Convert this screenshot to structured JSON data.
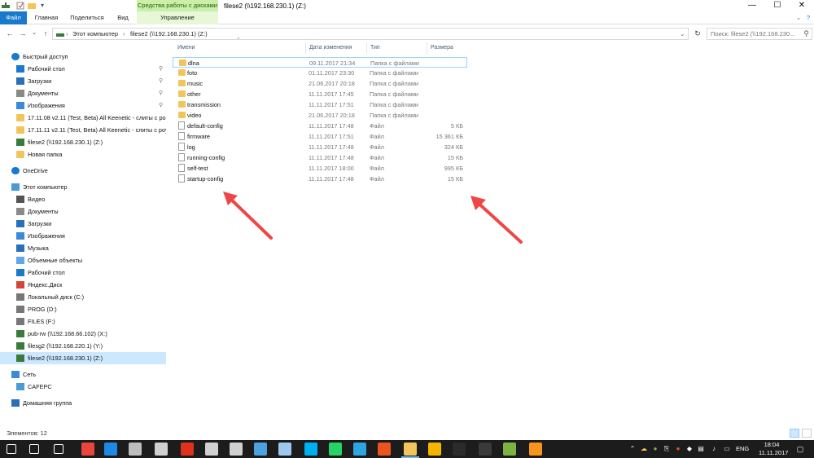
{
  "window": {
    "title": "filese2 (\\\\192.168.230.1) (Z:)",
    "ctx_tab_header": "Средства работы с дисками",
    "controls": {
      "minimize": "—",
      "maximize": "☐",
      "close": "✕"
    }
  },
  "ribbon": {
    "tabs": [
      "Файл",
      "Главная",
      "Поделиться",
      "Вид",
      "Управление"
    ]
  },
  "address": {
    "crumbs": [
      "Этот компьютер",
      "›",
      "filese2 (\\\\192.168.230.1) (Z:)"
    ],
    "search_placeholder": "Поиск: filese2 (\\\\192.168.230..."
  },
  "nav": {
    "items": [
      {
        "label": "Быстрый доступ",
        "icon": "star-icon",
        "pinned": false
      },
      {
        "label": "Рабочий стол",
        "icon": "desktop-icon",
        "pinned": true
      },
      {
        "label": "Загрузки",
        "icon": "download-icon",
        "pinned": true
      },
      {
        "label": "Документы",
        "icon": "documents-icon",
        "pinned": true
      },
      {
        "label": "Изображения",
        "icon": "pictures-icon",
        "pinned": true
      },
      {
        "label": "17.11.08 v2.11 (Test, Beta) All Keenetic - слиты с ро",
        "icon": "folder-icon",
        "pinned": false
      },
      {
        "label": "17.11.11 v2.11 (Test, Beta) All Keenetic - слиты с роу",
        "icon": "folder-icon",
        "pinned": false
      },
      {
        "label": "filese2 (\\\\192.168.230.1) (Z:)",
        "icon": "network-drive-icon",
        "pinned": false
      },
      {
        "label": "Новая папка",
        "icon": "folder-icon",
        "pinned": false
      },
      {
        "label": "OneDrive",
        "icon": "cloud-icon",
        "pinned": false
      },
      {
        "label": "Этот компьютер",
        "icon": "computer-icon",
        "pinned": false
      },
      {
        "label": "Видео",
        "icon": "video-icon",
        "pinned": false
      },
      {
        "label": "Документы",
        "icon": "documents-icon",
        "pinned": false
      },
      {
        "label": "Загрузки",
        "icon": "download-icon",
        "pinned": false
      },
      {
        "label": "Изображения",
        "icon": "pictures-icon",
        "pinned": false
      },
      {
        "label": "Музыка",
        "icon": "music-icon",
        "pinned": false
      },
      {
        "label": "Объемные объекты",
        "icon": "3d-objects-icon",
        "pinned": false
      },
      {
        "label": "Рабочий стол",
        "icon": "desktop-icon",
        "pinned": false
      },
      {
        "label": "Яндекс.Диск",
        "icon": "yandex-disk-icon",
        "pinned": false
      },
      {
        "label": "Локальный диск (C:)",
        "icon": "drive-icon",
        "pinned": false
      },
      {
        "label": "PROG (D:)",
        "icon": "drive-icon",
        "pinned": false
      },
      {
        "label": "FILES (F:)",
        "icon": "drive-icon",
        "pinned": false
      },
      {
        "label": "pub-rw (\\\\192.168.66.102) (X:)",
        "icon": "network-drive-icon",
        "pinned": false
      },
      {
        "label": "filesg2 (\\\\192.168.220.1) (Y:)",
        "icon": "network-drive-icon",
        "pinned": false
      },
      {
        "label": "filese2 (\\\\192.168.230.1) (Z:)",
        "icon": "network-drive-icon",
        "pinned": false,
        "selected": true
      },
      {
        "label": "Сеть",
        "icon": "network-icon",
        "pinned": false
      },
      {
        "label": "CAFEPC",
        "icon": "computer-icon",
        "pinned": false
      },
      {
        "label": "Домашняя группа",
        "icon": "homegroup-icon",
        "pinned": false
      }
    ]
  },
  "columns": {
    "name": "Имени",
    "date": "Дата изменения",
    "type": "Тип",
    "size": "Размера"
  },
  "files": [
    {
      "name": "dlna",
      "date": "09.11.2017 21:34",
      "type": "Папка с файлами",
      "size": "",
      "kind": "folder"
    },
    {
      "name": "foto",
      "date": "01.11.2017 23:30",
      "type": "Папка с файлами",
      "size": "",
      "kind": "folder"
    },
    {
      "name": "music",
      "date": "21.06.2017 20:18",
      "type": "Папка с файлами",
      "size": "",
      "kind": "folder"
    },
    {
      "name": "other",
      "date": "11.11.2017 17:45",
      "type": "Папка с файлами",
      "size": "",
      "kind": "folder"
    },
    {
      "name": "transmission",
      "date": "11.11.2017 17:51",
      "type": "Папка с файлами",
      "size": "",
      "kind": "folder"
    },
    {
      "name": "video",
      "date": "21.06.2017 20:18",
      "type": "Папка с файлами",
      "size": "",
      "kind": "folder"
    },
    {
      "name": "default-config",
      "date": "11.11.2017 17:48",
      "type": "Файл",
      "size": "5 КБ",
      "kind": "file"
    },
    {
      "name": "firmware",
      "date": "11.11.2017 17:51",
      "type": "Файл",
      "size": "15 361 КБ",
      "kind": "file"
    },
    {
      "name": "log",
      "date": "11.11.2017 17:48",
      "type": "Файл",
      "size": "324 КБ",
      "kind": "file"
    },
    {
      "name": "running-config",
      "date": "11.11.2017 17:48",
      "type": "Файл",
      "size": "15 КБ",
      "kind": "file"
    },
    {
      "name": "self-test",
      "date": "11.11.2017 18:00",
      "type": "Файл",
      "size": "995 КБ",
      "kind": "file"
    },
    {
      "name": "startup-config",
      "date": "11.11.2017 17:48",
      "type": "Файл",
      "size": "15 КБ",
      "kind": "file"
    }
  ],
  "status": {
    "items_count": "Элементов: 12"
  },
  "taskbar": {
    "apps": [
      {
        "icon": "windows-start-icon",
        "color": "#ffffff"
      },
      {
        "icon": "search-icon",
        "color": "#ffffff"
      },
      {
        "icon": "task-view-icon",
        "color": "#ffffff"
      },
      {
        "icon": "chrome-icon",
        "color": "#e8453c"
      },
      {
        "icon": "edge-icon",
        "color": "#1e88e5"
      },
      {
        "icon": "explorer-window-icon",
        "color": "#bdbdbd"
      },
      {
        "icon": "calculator-icon",
        "color": "#d0d0d0"
      },
      {
        "icon": "acrobat-icon",
        "color": "#e0301e"
      },
      {
        "icon": "store-icon",
        "color": "#d0d0d0"
      },
      {
        "icon": "settings-icon",
        "color": "#d0d0d0"
      },
      {
        "icon": "vpn-icon",
        "color": "#4aa3df"
      },
      {
        "icon": "remote-desktop-icon",
        "color": "#9ec7ef"
      },
      {
        "icon": "skype-icon",
        "color": "#00aff0"
      },
      {
        "icon": "whatsapp-icon",
        "color": "#25d366"
      },
      {
        "icon": "telegram-icon",
        "color": "#2ca5e0"
      },
      {
        "icon": "ubuntu-icon",
        "color": "#e95420"
      },
      {
        "icon": "file-explorer-icon",
        "color": "#f2c55c"
      },
      {
        "icon": "chrome-canary-icon",
        "color": "#f4b400"
      },
      {
        "icon": "terminal-icon",
        "color": "#2b2b2b"
      },
      {
        "icon": "putty-icon",
        "color": "#3a3a3a"
      },
      {
        "icon": "notepad-icon",
        "color": "#7cb342"
      },
      {
        "icon": "vlc-icon",
        "color": "#f7941d"
      }
    ],
    "lang": "ENG",
    "time": "18:04",
    "date": "11.11.2017"
  }
}
